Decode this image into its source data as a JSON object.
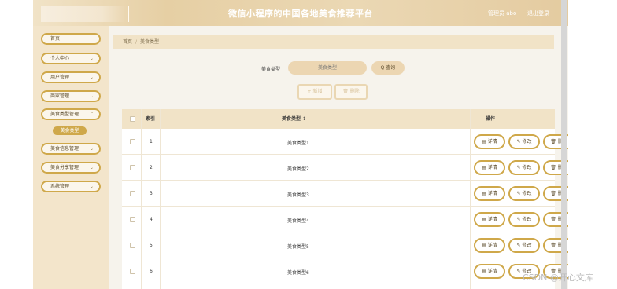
{
  "header": {
    "title": "微信小程序的中国各地美食推荐平台",
    "user": "管理员 abo",
    "logout": "退出登录"
  },
  "sidebar": {
    "items": [
      {
        "label": "首页",
        "chevron": ""
      },
      {
        "label": "个人中心",
        "chevron": "⌄"
      },
      {
        "label": "用户管理",
        "chevron": "⌄"
      },
      {
        "label": "商家管理",
        "chevron": "⌄"
      },
      {
        "label": "美食类型管理",
        "chevron": "⌃"
      },
      {
        "label": "美食信息管理",
        "chevron": "⌄"
      },
      {
        "label": "美食分享管理",
        "chevron": "⌄"
      },
      {
        "label": "系统管理",
        "chevron": "⌄"
      }
    ],
    "submenu_active": "美食类型"
  },
  "breadcrumb": {
    "home": "首页",
    "separator": "/",
    "current": "美食类型"
  },
  "search": {
    "label": "美食类型",
    "placeholder": "美食类型",
    "button": "Q 查询"
  },
  "actions": {
    "add": "+ 新增",
    "delete": "🗑 删除"
  },
  "table": {
    "headers": {
      "index": "索引",
      "type": "美食类型 ⇕",
      "ops": "操作"
    },
    "rows": [
      {
        "index": "1",
        "type": "美食类型1"
      },
      {
        "index": "2",
        "type": "美食类型2"
      },
      {
        "index": "3",
        "type": "美食类型3"
      },
      {
        "index": "4",
        "type": "美食类型4"
      },
      {
        "index": "5",
        "type": "美食类型5"
      },
      {
        "index": "6",
        "type": "美食类型6"
      }
    ],
    "op_labels": {
      "detail": "▤ 详情",
      "edit": "✎ 修改",
      "delete": "🗑 删除"
    }
  },
  "watermark": "CSDN @开心文库",
  "colors": {
    "accent": "#cfa84a",
    "header": "#e6cfa4",
    "sidebar": "#f3e5cb",
    "background": "#f6f3ec"
  }
}
